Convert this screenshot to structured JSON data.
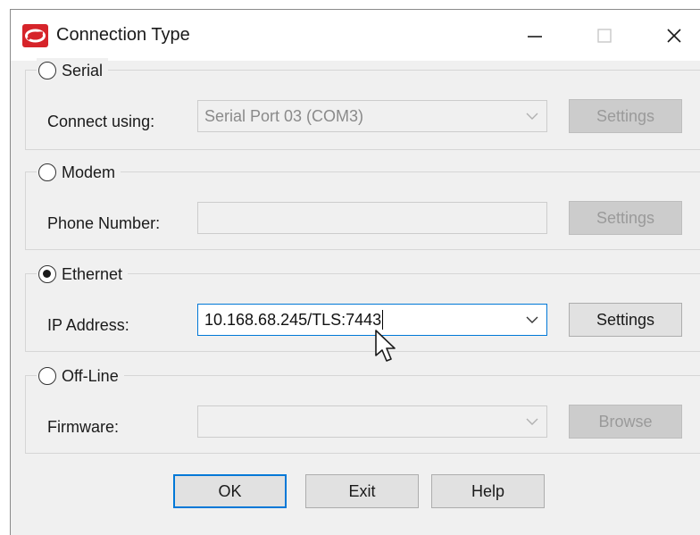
{
  "window": {
    "title": "Connection Type",
    "icon": "app-logo-icon",
    "controls": [
      "minimize-icon",
      "maximize-icon",
      "close-icon"
    ]
  },
  "groups": {
    "serial": {
      "label": "Serial",
      "selected": false,
      "row_label": "Connect using:",
      "field_value": "Serial Port 03 (COM3)",
      "button_label": "Settings",
      "enabled": false
    },
    "modem": {
      "label": "Modem",
      "selected": false,
      "row_label": "Phone Number:",
      "field_value": "",
      "button_label": "Settings",
      "enabled": false
    },
    "ethernet": {
      "label": "Ethernet",
      "selected": true,
      "row_label": "IP Address:",
      "field_value": "10.168.68.245/TLS:7443",
      "button_label": "Settings",
      "enabled": true
    },
    "offline": {
      "label": "Off-Line",
      "selected": false,
      "row_label": "Firmware:",
      "field_value": "",
      "button_label": "Browse",
      "enabled": false
    }
  },
  "buttons": {
    "ok": "OK",
    "exit": "Exit",
    "help": "Help"
  },
  "colors": {
    "accent": "#0078d7",
    "app_icon": "#d6242a",
    "dialog_bg": "#f0f0f0"
  }
}
